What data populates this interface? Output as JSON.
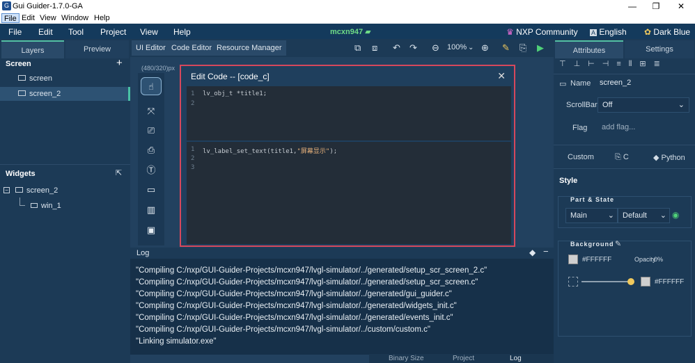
{
  "window": {
    "title": "Gui Guider-1.7.0-GA",
    "app_icon": "G",
    "minimize": "—",
    "maximize": "❐",
    "close": "✕"
  },
  "os_menu": [
    "File",
    "Edit",
    "View",
    "Window",
    "Help"
  ],
  "app_menu": {
    "items": [
      "File",
      "Edit",
      "Tool",
      "Project",
      "View",
      "Help"
    ],
    "project": "mcxn947",
    "community": "NXP Community",
    "language": "English",
    "theme": "Dark Blue"
  },
  "left": {
    "tabs": [
      "Layers",
      "Preview"
    ],
    "screen_title": "Screen",
    "screens": [
      "screen",
      "screen_2"
    ],
    "widgets_title": "Widgets",
    "widget_tree": [
      "screen_2",
      "win_1"
    ]
  },
  "center": {
    "tabs": [
      "UI Editor",
      "Code Editor",
      "Resource Manager"
    ],
    "resolution": "(480/320)px",
    "zoom": "100%"
  },
  "dialog": {
    "title": "Edit Code -- [code_c]",
    "top_lines": [
      "1",
      "2"
    ],
    "top_code": "lv_obj_t *title1;",
    "bottom_lines": [
      "1",
      "2",
      "3"
    ],
    "bottom_code_prefix": "lv_label_set_text(title1,",
    "bottom_code_string": "\"屏幕显示\"",
    "bottom_code_suffix": ");"
  },
  "log": {
    "title": "Log",
    "lines": [
      "\"Compiling C:/nxp/GUI-Guider-Projects/mcxn947/lvgl-simulator/../generated/setup_scr_screen_2.c\"",
      "\"Compiling C:/nxp/GUI-Guider-Projects/mcxn947/lvgl-simulator/../generated/setup_scr_screen.c\"",
      "\"Compiling C:/nxp/GUI-Guider-Projects/mcxn947/lvgl-simulator/../generated/gui_guider.c\"",
      "\"Compiling C:/nxp/GUI-Guider-Projects/mcxn947/lvgl-simulator/../generated/widgets_init.c\"",
      "\"Compiling C:/nxp/GUI-Guider-Projects/mcxn947/lvgl-simulator/../generated/events_init.c\"",
      "\"Compiling C:/nxp/GUI-Guider-Projects/mcxn947/lvgl-simulator/../custom/custom.c\"",
      "\"Linking simulator.exe\""
    ],
    "bottom_tabs": [
      "Binary Size",
      "Project",
      "Log"
    ]
  },
  "right": {
    "tabs": [
      "Attributes",
      "Settings"
    ],
    "name_label": "Name",
    "name_value": "screen_2",
    "scrollbar_label": "ScrollBar",
    "scrollbar_value": "Off",
    "flag_label": "Flag",
    "flag_placeholder": "add flag...",
    "custom_label": "Custom",
    "custom_c": "C",
    "custom_python": "Python",
    "style_label": "Style",
    "part_state_label": "Part & State",
    "part_value": "Main",
    "state_value": "Default",
    "background_label": "Background",
    "bg_color": "#FFFFFF",
    "opacity_label": "Opacity",
    "opacity_value": "0%",
    "gradient_color": "#FFFFFF"
  },
  "colors": {
    "accent": "#54c1a3",
    "dialog_border": "#d6485c",
    "project_green": "#6fdc86"
  }
}
